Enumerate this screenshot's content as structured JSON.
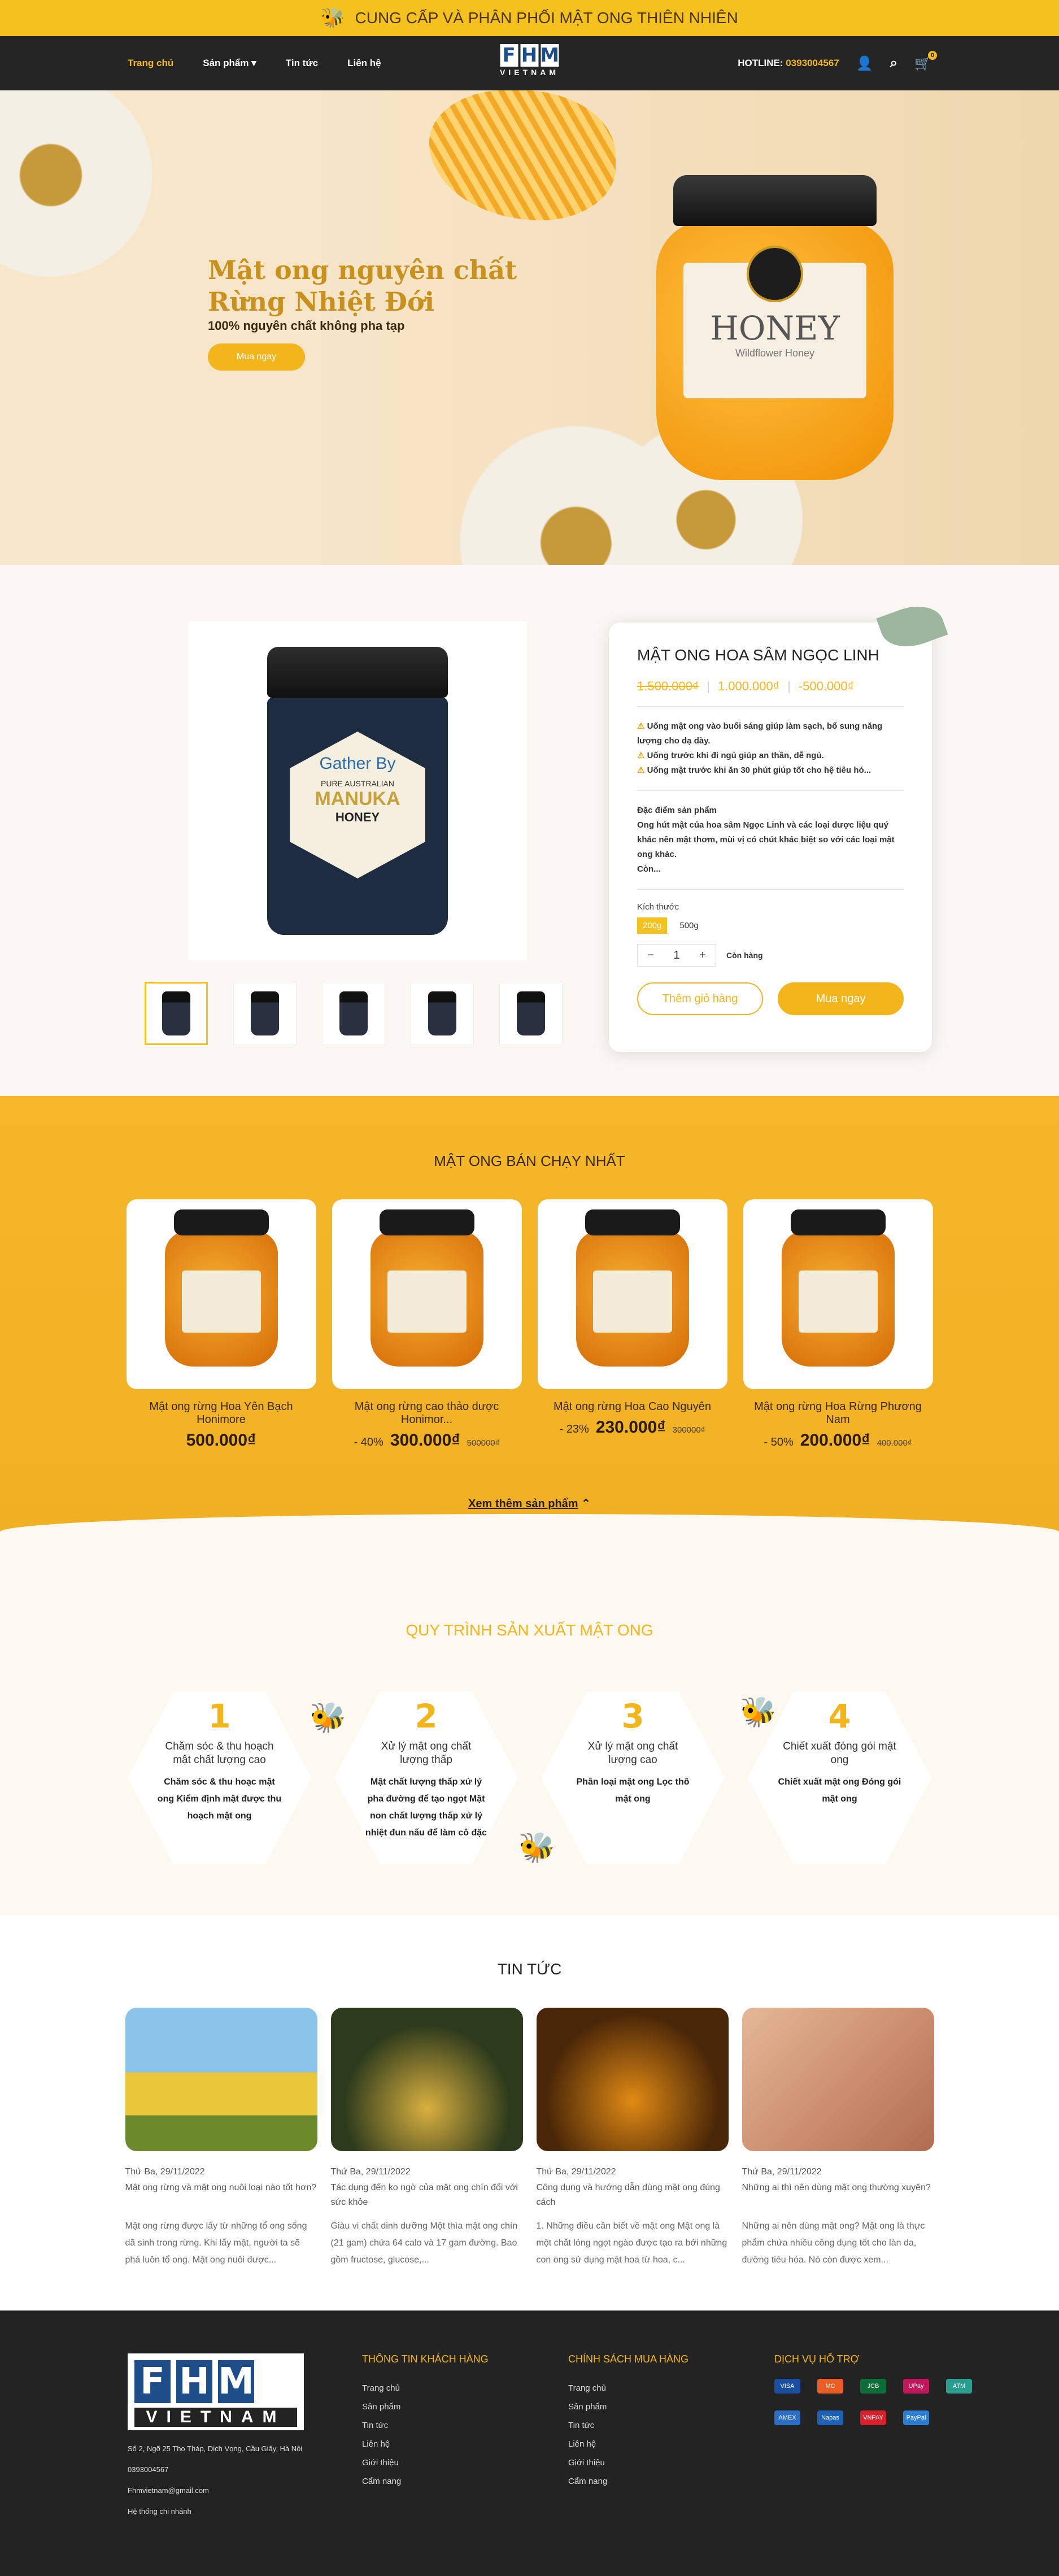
{
  "topbar": {
    "text": "CUNG CẤP VÀ PHÂN PHỐI MẬT ONG THIÊN NHIÊN",
    "icon": "bee-icon"
  },
  "nav": {
    "items": [
      "Trang chủ",
      "Sản phẩm",
      "Tin tức",
      "Liên hệ"
    ],
    "hotline_label": "HOTLINE:",
    "hotline": "0393004567",
    "cart_count": "0",
    "logo_letters": [
      "F",
      "H",
      "M"
    ],
    "logo_sub": "VIETNAM"
  },
  "hero": {
    "title_line1": "Mật ong nguyên chất",
    "title_line2": "Rừng Nhiệt Đới",
    "subtitle": "100% nguyên chất không pha tạp",
    "button": "Mua ngay",
    "jar_label": "HONEY",
    "jar_sub": "Wildflower Honey"
  },
  "product": {
    "name": "MẬT ONG HOA SÂM NGỌC LINH",
    "old_price": "1.500.000₫",
    "new_price": "1.000.000₫",
    "discount": "-500.000₫",
    "bullets": [
      "Uống mật ong vào buổi sáng giúp làm sạch, bổ sung năng lượng cho dạ dày.",
      "Uống trước khi đi ngủ giúp an thần, dễ ngủ.",
      "Uống mật trước khi ăn 30 phút giúp tốt cho hệ tiêu hó..."
    ],
    "feature_title": "Đặc điểm sản phẩm",
    "feature_text": "Ong hút mật của hoa sâm Ngọc Linh và các loại dược liệu quý khác nên mật thơm, mùi vị có chút khác biệt so với các loại mật ong khác.",
    "feature_more": "Còn...",
    "size_label": "Kích thước",
    "sizes": [
      "200g",
      "500g"
    ],
    "qty": "1",
    "stock": "Còn hàng",
    "add_cart": "Thêm giỏ hàng",
    "buy_now": "Mua ngay",
    "jar_brand": "Gather By",
    "jar_pure": "PURE AUSTRALIAN",
    "jar_manuka": "MANUKA",
    "jar_honey": "HONEY"
  },
  "bestsellers": {
    "title": "MẬT ONG BÁN CHẠY NHẤT",
    "items": [
      {
        "name": "Mật ong rừng Hoa Yên Bạch Honimore",
        "discount": "",
        "price": "500.000₫",
        "old": ""
      },
      {
        "name": "Mật ong rừng cao thảo dược Honimor...",
        "discount": "- 40%",
        "price": "300.000₫",
        "old": "500000₫"
      },
      {
        "name": "Mật ong rừng Hoa Cao Nguyên",
        "discount": "- 23%",
        "price": "230.000₫",
        "old": "300000₫"
      },
      {
        "name": "Mật ong rừng Hoa Rừng Phương Nam",
        "discount": "- 50%",
        "price": "200.000₫",
        "old": "400.000₫"
      }
    ],
    "more": "Xem thêm sản phẩm"
  },
  "process": {
    "title": "QUY TRÌNH SẢN XUẤT MẬT ONG",
    "steps": [
      {
        "n": "1",
        "title": "Chăm sóc & thu hoạch mật chất lượng cao",
        "desc": "Chăm sóc & thu hoạc mật ong Kiểm định mật được thu hoạch mật ong"
      },
      {
        "n": "2",
        "title": "Xử lý mật ong chất lượng thấp",
        "desc": "Mật chất lượng thấp xử lý pha đường để tạo ngọt Mật non chất lượng thấp xử lý nhiệt đun nấu để làm cô đặc"
      },
      {
        "n": "3",
        "title": "Xử lý mật ong chất lượng cao",
        "desc": "Phân loại mật ong Lọc thô mật ong"
      },
      {
        "n": "4",
        "title": "Chiết xuất đóng gói mật ong",
        "desc": "Chiết xuất mật ong Đóng gói mật ong"
      }
    ]
  },
  "news": {
    "title": "TIN TỨC",
    "posts": [
      {
        "date": "Thứ Ba, 29/11/2022",
        "title": "Mật ong rừng và mật ong nuôi loại nào tốt hơn?",
        "excerpt": "Mật ong rừng được lấy từ những tổ ong sống dã sinh trong rừng. Khi lấy mật, người ta sẽ phá luôn tổ ong. Mật ong nuôi được..."
      },
      {
        "date": "Thứ Ba, 29/11/2022",
        "title": "Tác dụng đến ko ngờ của mật ong chín đối với sức khỏe",
        "excerpt": "Giàu vi chất dinh dưỡng Một thìa mật ong chín (21 gam) chứa 64 calo và 17 gam đường. Bao gồm fructose, glucose,..."
      },
      {
        "date": "Thứ Ba, 29/11/2022",
        "title": "Công dụng và hướng dẫn dùng mật ong đúng cách",
        "excerpt": "1. Những điều cần biết về mật ong Mật ong là một chất lỏng ngọt ngào được tạo ra bởi những con ong sử dụng mật hoa từ hoa, c..."
      },
      {
        "date": "Thứ Ba, 29/11/2022",
        "title": "Những ai thì nên dùng mật ong thường xuyên?",
        "excerpt": "Những ai nên dùng mật ong? Mật ong là thực phẩm chứa nhiều công dụng tốt cho làn da, đường tiêu hóa. Nó còn được xem..."
      }
    ]
  },
  "footer": {
    "address": "Số 2, Ngõ 25 Thọ Tháp, Dịch Vọng, Cầu Giấy, Hà Nội",
    "phone": "0393004567",
    "email": "Fhmvietnam@gmail.com",
    "branches": "Hệ thống chi nhánh",
    "col1_title": "THÔNG TIN KHÁCH HÀNG",
    "col1": [
      "Trang chủ",
      "Sản phẩm",
      "Tin tức",
      "Liên hệ",
      "Giới thiệu",
      "Cẩm nang"
    ],
    "col2_title": "CHÍNH SÁCH MUA HÀNG",
    "col2": [
      "Trang chủ",
      "Sản phẩm",
      "Tin tức",
      "Liên hệ",
      "Giới thiệu",
      "Cẩm nang"
    ],
    "col3_title": "DỊCH VỤ HỖ TRỢ",
    "payments": [
      "VISA",
      "MC",
      "JCB",
      "UPay",
      "ATM",
      "",
      "AMEX",
      "Napas",
      "VNPAY",
      "PayPal"
    ],
    "payment_colors": [
      "#1a4fa0",
      "#eb5d22",
      "#0d6e3a",
      "#c2185b",
      "#2a9d8f",
      "#222",
      "#2d6fc5",
      "#1f62b5",
      "#d9202d",
      "#2d7dd2"
    ]
  }
}
